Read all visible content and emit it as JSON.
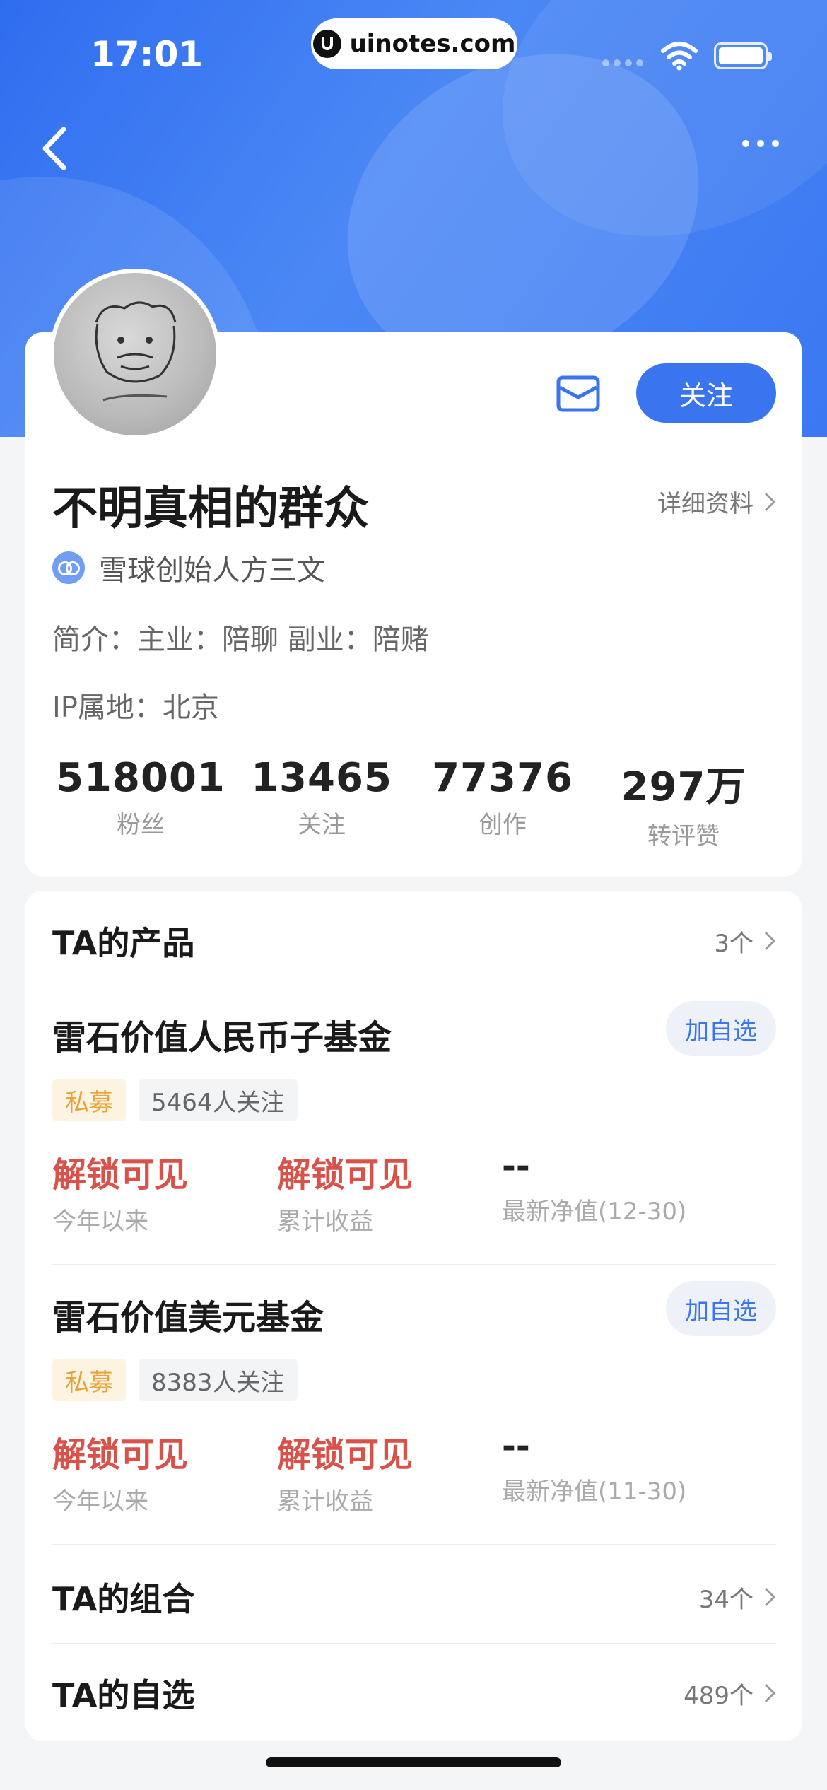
{
  "status_bar": {
    "time": "17:01",
    "site": "uinotes.com"
  },
  "header": {
    "back_icon": "chevron-left-icon",
    "more_icon": "more-dots-icon"
  },
  "profile": {
    "follow_label": "关注",
    "username": "不明真相的群众",
    "detail_link": "详细资料",
    "verification": "雪球创始人方三文",
    "bio": "简介：主业：陪聊 副业：陪赌",
    "ip_location": "IP属地：北京",
    "stats": [
      {
        "value": "518001",
        "label": "粉丝"
      },
      {
        "value": "13465",
        "label": "关注"
      },
      {
        "value": "77376",
        "label": "创作"
      },
      {
        "value": "297万",
        "label": "转评赞"
      }
    ]
  },
  "products": {
    "title": "TA的产品",
    "count": "3个",
    "funds": [
      {
        "name": "雷石价值人民币子基金",
        "add_label": "加自选",
        "tag_type": "私募",
        "tag_followers": "5464人关注",
        "metrics": [
          {
            "value": "解锁可见",
            "label": "今年以来"
          },
          {
            "value": "解锁可见",
            "label": "累计收益"
          },
          {
            "value": "--",
            "label": "最新净值(12-30)"
          }
        ]
      },
      {
        "name": "雷石价值美元基金",
        "add_label": "加自选",
        "tag_type": "私募",
        "tag_followers": "8383人关注",
        "metrics": [
          {
            "value": "解锁可见",
            "label": "今年以来"
          },
          {
            "value": "解锁可见",
            "label": "累计收益"
          },
          {
            "value": "--",
            "label": "最新净值(11-30)"
          }
        ]
      }
    ]
  },
  "portfolio": {
    "title": "TA的组合",
    "count": "34个"
  },
  "watchlist": {
    "title": "TA的自选",
    "count": "489个"
  },
  "colors": {
    "accent": "#3a74ef",
    "locked_red": "#d9524a",
    "private_tag": "#e8a33a"
  }
}
